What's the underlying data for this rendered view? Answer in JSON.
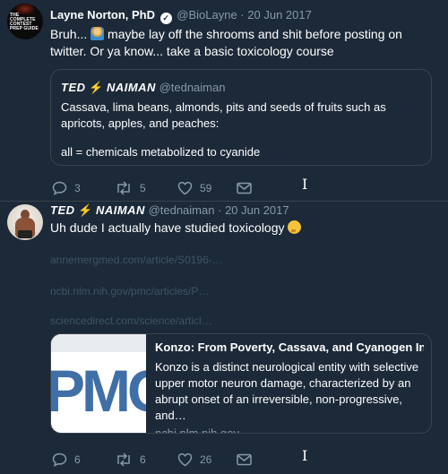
{
  "tweet1": {
    "avatar_text": "THE COMPLETE CONTEST PREP GUIDE",
    "name": "Layne Norton, PhD",
    "handle": "@BioLayne",
    "separator": "·",
    "date": "20 Jun 2017",
    "text_part1": "Bruh...",
    "emoji_name": "person-facepalming-emoji",
    "text_part2": "maybe lay off the shrooms and shit before posting on twitter. Or ya know... take a basic toxicology course",
    "quote": {
      "name": "TED",
      "name2": "NAIMAN",
      "bolt": "⚡",
      "handle": "@tednaiman",
      "line1": "Cassava, lima beans, almonds, pits and seeds of fruits such as apricots, apples, and peaches:",
      "line2": "all = chemicals metabolized to cyanide"
    },
    "actions": {
      "replies": "3",
      "retweets": "5",
      "likes": "59"
    }
  },
  "tweet2": {
    "name": "TED",
    "name2": "NAIMAN",
    "bolt": "⚡",
    "handle": "@tednaiman",
    "separator": "·",
    "date": "20 Jun 2017",
    "text": "Uh dude I actually have studied toxicology",
    "emoji_name": "thinking-face-emoji",
    "links": [
      "annemergmed.com/article/S0196-…",
      "ncbi.nlm.nih.gov/pmc/articles/P…",
      "sciencedirect.com/science/articl…"
    ],
    "card": {
      "image_text": "PMC",
      "title": "Konzo: From Poverty, Cassava, and Cyanogen Inta…",
      "description": "Konzo is a distinct neurological entity with selective upper motor neuron damage, characterized by an abrupt onset of an irreversible, non-progressive, and…",
      "domain": "ncbi.nlm.nih.gov"
    },
    "actions": {
      "replies": "6",
      "retweets": "6",
      "likes": "26"
    }
  },
  "cursor": "I",
  "colors": {
    "background": "#1c2938",
    "secondary_text": "#8899a6",
    "border": "#38444d",
    "bolt": "#f5a623"
  }
}
